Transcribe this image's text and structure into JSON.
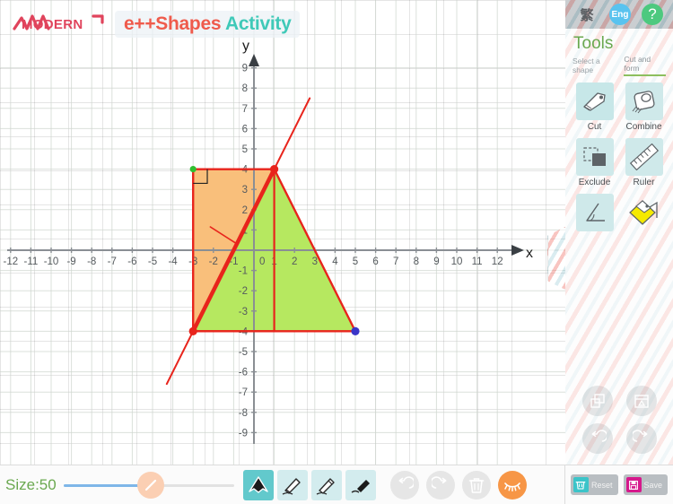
{
  "header": {
    "brand": "MODERN",
    "title_part1": "e++Shapes",
    "title_part2": "Activity",
    "lang_zh": "繁",
    "lang_en": "Eng",
    "help": "?"
  },
  "tools_panel": {
    "title": "Tools",
    "sub_select": "Select a shape",
    "sub_cutform": "Cut and form",
    "items": [
      {
        "label": "Cut",
        "icon": "cut-icon"
      },
      {
        "label": "Combine",
        "icon": "combine-icon"
      },
      {
        "label": "Exclude",
        "icon": "exclude-icon"
      },
      {
        "label": "Ruler",
        "icon": "ruler-icon"
      },
      {
        "label": "",
        "icon": "angle-icon"
      },
      {
        "label": "",
        "icon": "fold-icon"
      }
    ],
    "bottom_actions": [
      {
        "icon": "duplicate-icon"
      },
      {
        "icon": "delete-shape-icon"
      },
      {
        "icon": "undo-icon"
      },
      {
        "icon": "redo-icon"
      }
    ]
  },
  "bottom_bar": {
    "size_label": "Size:50",
    "size_value": 50,
    "draw_tools": [
      {
        "icon": "polygon-tool-icon",
        "active": true
      },
      {
        "icon": "pencil-tool-icon",
        "active": false
      },
      {
        "icon": "pen-tool-icon",
        "active": false
      },
      {
        "icon": "eraser-tool-icon",
        "active": false
      }
    ],
    "actions": [
      {
        "icon": "undo-icon"
      },
      {
        "icon": "redo-icon"
      },
      {
        "icon": "trash-icon"
      },
      {
        "icon": "eye-icon"
      }
    ],
    "reset_label": "Reset",
    "save_label": "Save"
  },
  "colors": {
    "axis": "#8a8f94",
    "grid": "#cfd6cf",
    "shape_stroke": "#e8241c",
    "green_fill": "#b6e860",
    "orange_fill": "#f9bf7b",
    "vertex_red": "#e8241c",
    "vertex_green": "#2fbf2f",
    "vertex_blue": "#3a35c8",
    "tick_text": "#555a5e"
  },
  "chart_data": {
    "type": "scatter",
    "title": "",
    "xlabel": "x",
    "ylabel": "y",
    "xlim": [
      -12,
      12
    ],
    "ylim": [
      -9,
      9
    ],
    "grid": true,
    "x_ticks": [
      -12,
      -11,
      -10,
      -9,
      -8,
      -7,
      -6,
      -5,
      -4,
      -3,
      -2,
      -1,
      0,
      1,
      2,
      3,
      4,
      5,
      6,
      7,
      8,
      9,
      10,
      11,
      12
    ],
    "y_ticks": [
      -9,
      -8,
      -7,
      -6,
      -5,
      -4,
      -3,
      -2,
      -1,
      0,
      1,
      2,
      3,
      4,
      5,
      6,
      7,
      8,
      9
    ],
    "shapes": [
      {
        "name": "orange-rectangle",
        "type": "polygon",
        "fill": "#f9bf7b",
        "stroke": "#e8241c",
        "points": [
          [
            -3,
            4
          ],
          [
            1,
            4
          ],
          [
            1,
            -4
          ],
          [
            -3,
            -4
          ]
        ]
      },
      {
        "name": "green-triangle",
        "type": "polygon",
        "fill": "#b6e860",
        "stroke": "#e8241c",
        "points": [
          [
            1,
            4
          ],
          [
            5,
            -4
          ],
          [
            -3,
            -4
          ]
        ]
      },
      {
        "name": "cut-line",
        "type": "line",
        "stroke": "#e8241c",
        "points": [
          [
            -4.3,
            -6.6
          ],
          [
            2.75,
            7.5
          ]
        ],
        "thick_segment": [
          [
            -3,
            -4
          ],
          [
            1,
            4
          ]
        ]
      },
      {
        "name": "direction-pointer",
        "type": "line",
        "stroke": "#e8241c",
        "points": [
          [
            -2.15,
            1.15
          ],
          [
            -0.9,
            0.35
          ]
        ]
      },
      {
        "name": "right-angle-marker",
        "type": "polyline",
        "stroke": "#222222",
        "points": [
          [
            -3,
            3.3
          ],
          [
            -2.3,
            3.3
          ],
          [
            -2.3,
            4
          ]
        ]
      }
    ],
    "vertices": [
      {
        "name": "vertex-top",
        "x": 1,
        "y": 4,
        "color": "#e8241c"
      },
      {
        "name": "vertex-bottom-left",
        "x": -3,
        "y": -4,
        "color": "#e8241c"
      },
      {
        "name": "vertex-bottom-right",
        "x": 5,
        "y": -4,
        "color": "#3a35c8"
      },
      {
        "name": "vertex-rect-topleft",
        "x": -3,
        "y": 4,
        "color": "#2fbf2f"
      }
    ]
  }
}
